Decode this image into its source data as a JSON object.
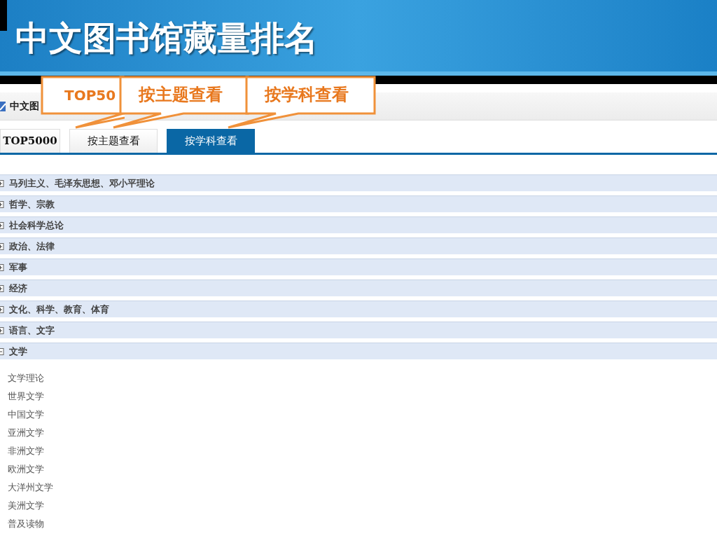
{
  "title": "中文图书馆藏量排名",
  "breadcrumb": "中文图",
  "tabs": [
    {
      "label": "TOP5000",
      "selected": false
    },
    {
      "label": "按主题查看",
      "selected": false
    },
    {
      "label": "按学科查看",
      "selected": true
    }
  ],
  "categories": [
    {
      "label": "马列主义、毛泽东思想、邓小平理论",
      "expanded": false
    },
    {
      "label": "哲学、宗教",
      "expanded": false
    },
    {
      "label": "社会科学总论",
      "expanded": false
    },
    {
      "label": "政治、法律",
      "expanded": false
    },
    {
      "label": "军事",
      "expanded": false
    },
    {
      "label": "经济",
      "expanded": false
    },
    {
      "label": "文化、科学、教育、体育",
      "expanded": false
    },
    {
      "label": "语言、文字",
      "expanded": false
    },
    {
      "label": "文学",
      "expanded": true,
      "children": [
        "文学理论",
        "世界文学",
        "中国文学",
        "亚洲文学",
        "非洲文学",
        "欧洲文学",
        "大洋州文学",
        "美洲文学",
        "普及读物"
      ]
    }
  ],
  "callouts": [
    {
      "text": "TOP50"
    },
    {
      "text": "按主题查看"
    },
    {
      "text": "按学科查看"
    }
  ]
}
